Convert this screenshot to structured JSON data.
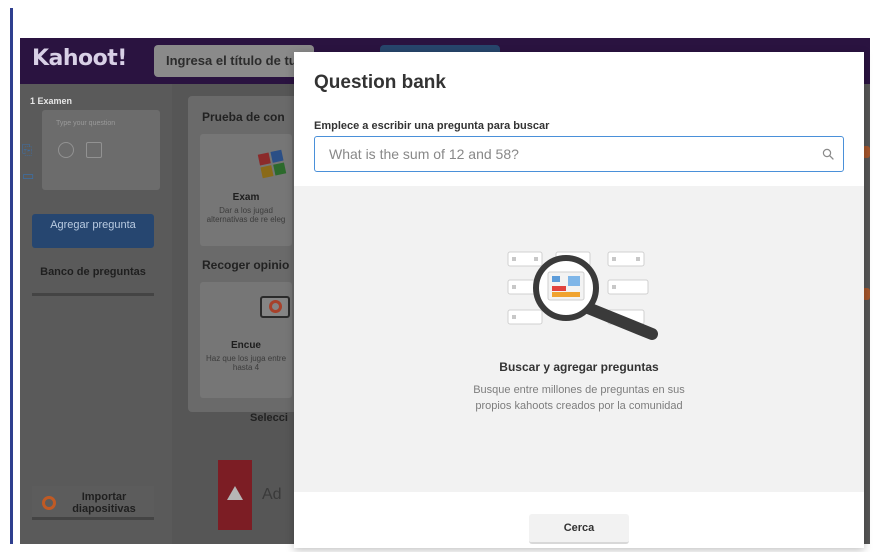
{
  "app": {
    "logo": "Kahoot!",
    "title_input_placeholder": "Ingresa el título de tu kahoot...",
    "sidebar": {
      "slide_label": "1  Examen",
      "thumb_placeholder": "Type your question",
      "add_question_label": "Agregar pregunta",
      "question_bank_label": "Banco de preguntas",
      "import_label": "Importar diapositivas"
    },
    "middle": {
      "section_quiz": "Prueba de con",
      "quiz_card_name": "Exam",
      "quiz_card_desc": "Dar a los jugad alternativas de re eleg",
      "section_opinion": "Recoger opinio",
      "poll_card_name": "Encue",
      "poll_card_desc": "Haz que los juga entre hasta 4",
      "below_label": "Selecci",
      "add_label": "Ad"
    }
  },
  "modal": {
    "title": "Question bank",
    "search_label": "Emplece a escribir una pregunta para buscar",
    "search_placeholder": "What is the sum of 12 and 58?",
    "empty_title": "Buscar y agregar preguntas",
    "empty_description": "Busque entre millones de preguntas en sus propios kahoots creados por la comunidad",
    "close_label": "Cerca"
  },
  "colors": {
    "accent": "#4a90d9",
    "kahoot_purple": "#46178f",
    "overlay_bg": "#565656",
    "modal_bg": "#ffffff",
    "empty_bg": "#f2f2f2"
  },
  "icons": {
    "search": "magnifier-icon",
    "illustration": "magnifying-glass-icon"
  }
}
